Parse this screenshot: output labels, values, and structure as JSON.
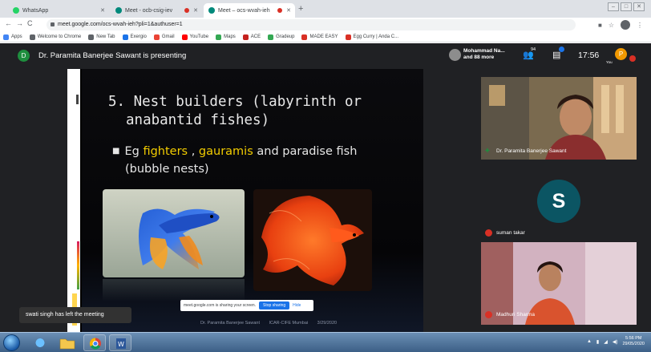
{
  "browser": {
    "tabs": [
      {
        "label": "WhatsApp",
        "favicon_color": "#25d366",
        "active": false
      },
      {
        "label": "Meet - ocb-csig-iev",
        "favicon_color": "#00897b",
        "active": false,
        "recording": true
      },
      {
        "label": "Meet – ocs-wvah-ieh",
        "favicon_color": "#00897b",
        "active": true,
        "recording": true
      }
    ],
    "new_tab_label": "+",
    "url": "meet.google.com/ocs-wvah-ieh?pli=1&authuser=1",
    "bookmarks": [
      {
        "label": "Apps",
        "color": "#4285f4"
      },
      {
        "label": "Welcome to Chrome",
        "color": "#5f6368"
      },
      {
        "label": "New Tab",
        "color": "#5f6368"
      },
      {
        "label": "Exergio",
        "color": "#1a73e8"
      },
      {
        "label": "Gmail",
        "color": "#ea4335"
      },
      {
        "label": "YouTube",
        "color": "#ff0000"
      },
      {
        "label": "Maps",
        "color": "#34a853"
      },
      {
        "label": "ACE",
        "color": "#c5221f"
      },
      {
        "label": "Gradeup",
        "color": "#34a853"
      },
      {
        "label": "MADE EASY",
        "color": "#d93025"
      },
      {
        "label": "Egg Curry | Anda C...",
        "color": "#d93025"
      }
    ]
  },
  "meet": {
    "presenter_initial": "D",
    "presenting_text": "Dr. Paramita Banerjee Sawant is presenting",
    "participants_text_line1": "Mohammad Na...",
    "participants_text_line2": "and 88 more",
    "people_count": "94",
    "clock": "17:56",
    "you_label": "You",
    "you_initial": "P"
  },
  "slide": {
    "title_line1": "5. Nest builders (labyrinth or",
    "title_line2": "anabantid fishes)",
    "bullet_prefix": "Eg",
    "highlight1": "fighters",
    "sep1": ",",
    "highlight2": "gauramis",
    "bullet_rest_line1": "and paradise fish",
    "bullet_line2": "(bubble nests)",
    "footer_author": "Dr. Paramita Banerjee Sawant",
    "footer_org": "ICAR-CIFE Mumbai",
    "footer_date": "3/29/2020"
  },
  "share_notice": {
    "text": "meet.google.com is sharing your screen.",
    "stop_label": "Stop sharing",
    "hide_label": "Hide"
  },
  "toast": "swati singh has left the meeting",
  "tiles": [
    {
      "name": "Dr. Paramita Banerjee Sawant"
    },
    {
      "name": "suman takar",
      "initial": "S"
    },
    {
      "name": "Madhuri Sharma"
    }
  ],
  "taskbar": {
    "time": "5:56 PM",
    "date": "29/05/2020"
  }
}
